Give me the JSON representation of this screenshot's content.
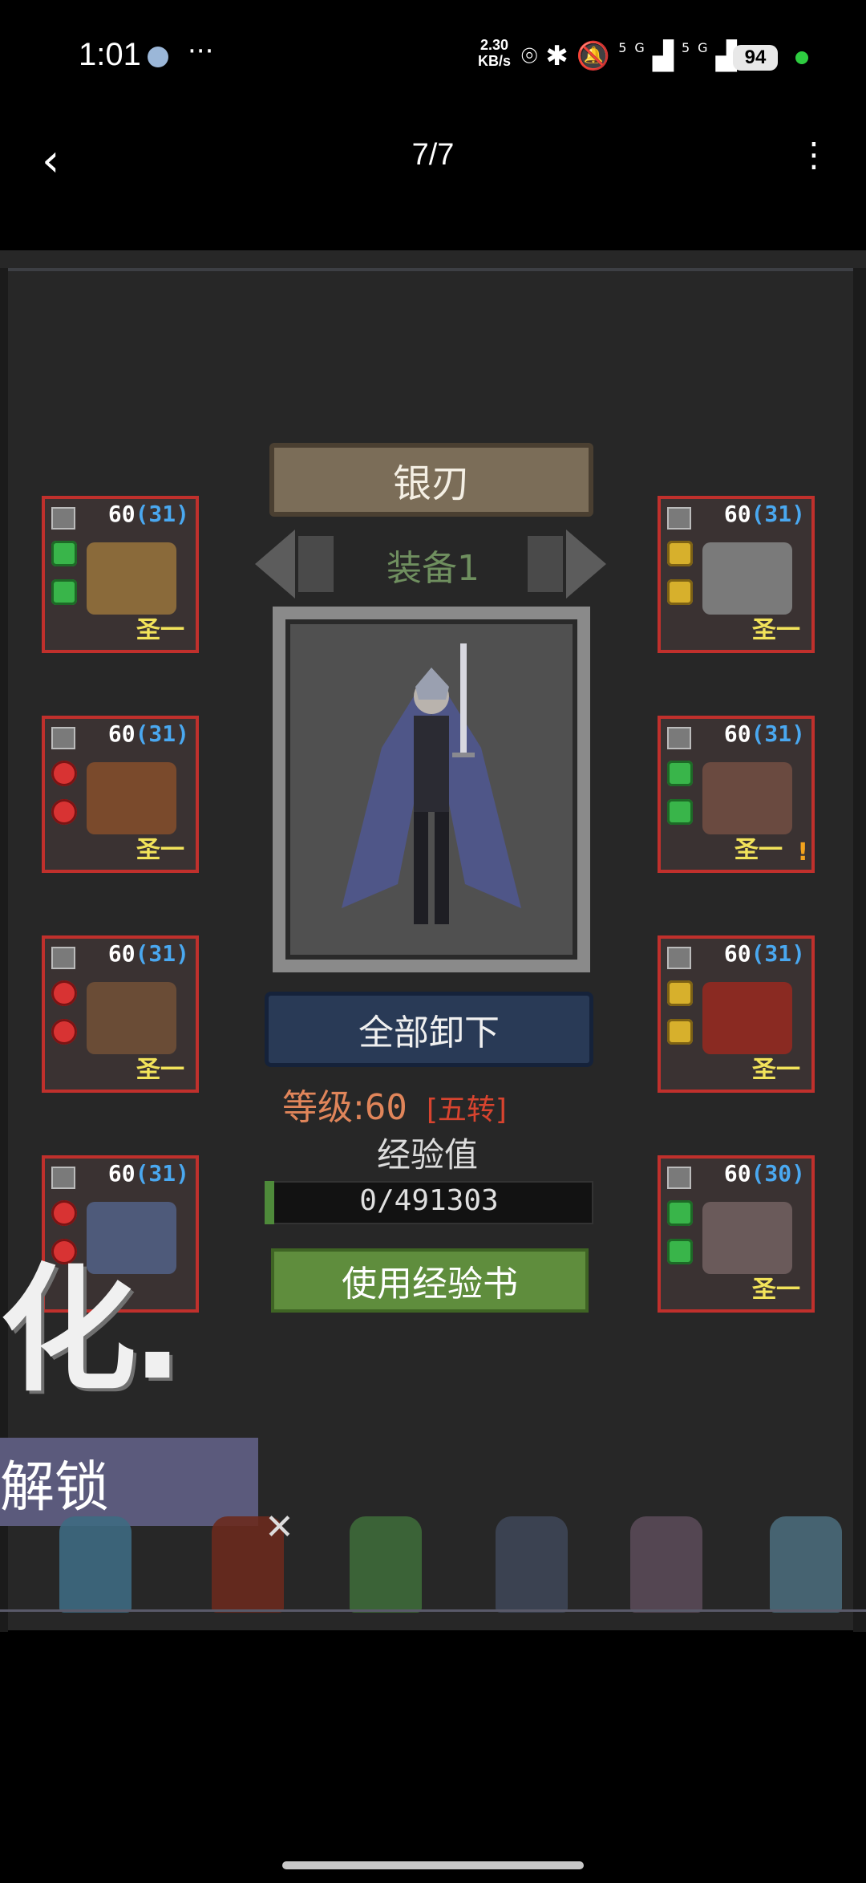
{
  "status_bar": {
    "time": "1:01",
    "ellipsis": "···",
    "net_speed_value": "2.30",
    "net_speed_unit": "KB/s",
    "network_label": "5G",
    "battery": "94"
  },
  "nav": {
    "page_counter": "7/7"
  },
  "character": {
    "name": "银刃",
    "equip_set_label": "装备1",
    "unequip_all_label": "全部卸下",
    "level_label": "等级:",
    "level_value": "60",
    "rebirth_label": "[五转]",
    "exp_label": "经验值",
    "exp_value": "0/491303",
    "exp_fraction": 0,
    "use_exp_book_label": "使用经验书"
  },
  "slots": {
    "left": [
      {
        "level": "60",
        "sublevel": "(31)",
        "grade": "圣一",
        "gems": [
          "green",
          "green"
        ],
        "color": "#8a6a3a"
      },
      {
        "level": "60",
        "sublevel": "(31)",
        "grade": "圣一",
        "gems": [
          "red",
          "red"
        ],
        "color": "#7a4a2c"
      },
      {
        "level": "60",
        "sublevel": "(31)",
        "grade": "圣一",
        "gems": [
          "red",
          "red"
        ],
        "color": "#6a4c36"
      },
      {
        "level": "60",
        "sublevel": "(31)",
        "grade": "",
        "gems": [
          "red",
          "red"
        ],
        "color": "#4e5a7a"
      }
    ],
    "right": [
      {
        "level": "60",
        "sublevel": "(31)",
        "grade": "圣一",
        "gems": [
          "gold",
          "gold"
        ],
        "color": "#7a7a7a"
      },
      {
        "level": "60",
        "sublevel": "(31)",
        "grade": "圣一",
        "gems": [
          "green",
          "green"
        ],
        "color": "#6a4a40",
        "warning": "!"
      },
      {
        "level": "60",
        "sublevel": "(31)",
        "grade": "圣一",
        "gems": [
          "gold",
          "gold"
        ],
        "color": "#8a2a22"
      },
      {
        "level": "60",
        "sublevel": "(30)",
        "grade": "圣一",
        "gems": [
          "green",
          "green"
        ],
        "color": "#6a5a5a"
      }
    ]
  },
  "promo": {
    "big_text": "化.",
    "unlock_text": "解锁"
  },
  "colors": {
    "slot_border": "#c0302c",
    "sublevel": "#4aa8f0",
    "grade": "#f2e35a",
    "level_text": "#e0855a",
    "rebirth": "#d8442f",
    "exp_book_button": "#5f8d3d",
    "unequip_button": "#293a56"
  },
  "heroes": [
    {
      "name": "hero-ice-mage",
      "color": "#3e6a82"
    },
    {
      "name": "hero-demon",
      "color": "#6a2a1e"
    },
    {
      "name": "hero-archer",
      "color": "#3e6a3a"
    },
    {
      "name": "hero-warrior",
      "color": "#3e4656"
    },
    {
      "name": "hero-valkyrie",
      "color": "#5a4a58"
    },
    {
      "name": "hero-gunner",
      "color": "#4a6a7a"
    }
  ]
}
